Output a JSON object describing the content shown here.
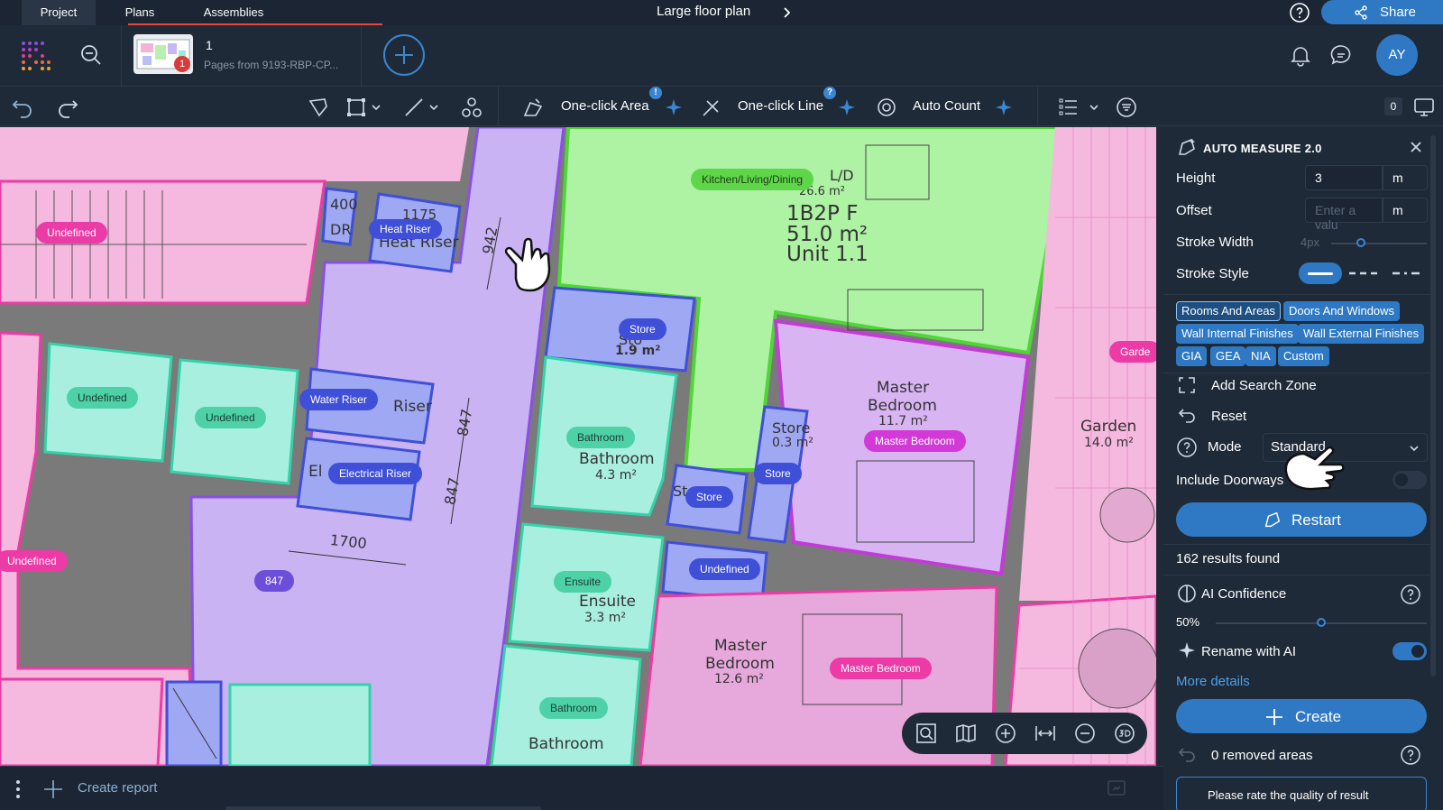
{
  "top_tabs": [
    "Project",
    "Plans",
    "Assemblies"
  ],
  "doc_title": "Large floor plan",
  "share_label": "Share",
  "page": {
    "number": "1",
    "subtitle": "Pages from 9193-RBP-CP...",
    "badge": "1"
  },
  "avatar_initials": "AY",
  "toolbar": {
    "one_click_area": "One-click Area",
    "one_click_line": "One-click Line",
    "auto_count": "Auto Count",
    "area_badge": "!",
    "line_badge": "?",
    "count": "0"
  },
  "plan": {
    "labels": {
      "undefined_1": "Undefined",
      "heat_riser": "Heat Riser",
      "kitchen": "Kitchen/Living/Dining",
      "undefined_2": "Undefined",
      "undefined_3": "Undefined",
      "water_riser": "Water Riser",
      "electrical_riser": "Electrical Riser",
      "store_1": "Store",
      "bathroom_1": "Bathroom",
      "master_bedroom_1": "Master Bedroom",
      "store_2": "Store",
      "store_3": "Store",
      "undefined_4": "Undefined",
      "undefined_5": "Undefined",
      "ensuite": "Ensuite",
      "master_bedroom_2": "Master Bedroom",
      "bathroom_2": "Bathroom",
      "n847": "847",
      "garden_pill": "Garde"
    },
    "texts": {
      "unit_type": "1B2P F",
      "unit_area": "51.0 m²",
      "unit_name": "Unit 1.1",
      "kitchen_partial": "L/D",
      "kitchen_area": "26.6 m²",
      "store_area": "1.9 m²",
      "store_partial": "Sto",
      "bathroom": "Bathroom",
      "bathroom_area": "4.3 m²",
      "master": "Master",
      "bedroom": "Bedroom",
      "master1_area": "11.7 m²",
      "store2": "Store",
      "store2_area": "0.3 m²",
      "garden": "Garden",
      "garden_area": "14.0 m²",
      "ensuite": "Ensuite",
      "ensuite_area": "3.3 m²",
      "master2_area": "12.6 m²",
      "heat_riser_dim": "1175",
      "heat_riser_text": "Heat Riser",
      "water_riser_text": "Riser",
      "dim_400": "400",
      "dr": "DR",
      "dim_942": "942",
      "dim_847a": "847",
      "dim_847b": "847",
      "dim_1700": "1700",
      "el_text": "El",
      "st_text": "St",
      "bathroom_bottom": "Bathroom"
    }
  },
  "panel": {
    "title": "AUTO MEASURE 2.0",
    "height_label": "Height",
    "height_value": "3",
    "height_unit": "m",
    "offset_label": "Offset",
    "offset_placeholder": "Enter a valu",
    "offset_unit": "m",
    "stroke_width_label": "Stroke Width",
    "stroke_width_value": "4px",
    "stroke_style_label": "Stroke Style",
    "chips": [
      "Rooms And Areas",
      "Doors And Windows",
      "Wall Internal Finishes",
      "Wall External Finishes",
      "GIA",
      "GEA",
      "NIA",
      "Custom"
    ],
    "add_search_zone": "Add Search Zone",
    "reset": "Reset",
    "mode_label": "Mode",
    "mode_value": "Standard",
    "include_doorways": "Include Doorways",
    "include_doorways_on": false,
    "restart": "Restart",
    "results": "162 results found",
    "ai_confidence": "AI Confidence",
    "ai_confidence_value": "50%",
    "ai_confidence_fraction": 0.5,
    "rename_ai": "Rename with AI",
    "rename_ai_on": true,
    "more_details": "More details",
    "create": "Create",
    "removed": "0 removed areas",
    "rate": "Please rate the quality of result"
  },
  "bottom": {
    "create_report": "Create report"
  },
  "colors": {
    "accent": "#2f79c4",
    "tab_line": "#e6473a",
    "bg": "#1f2a38"
  }
}
